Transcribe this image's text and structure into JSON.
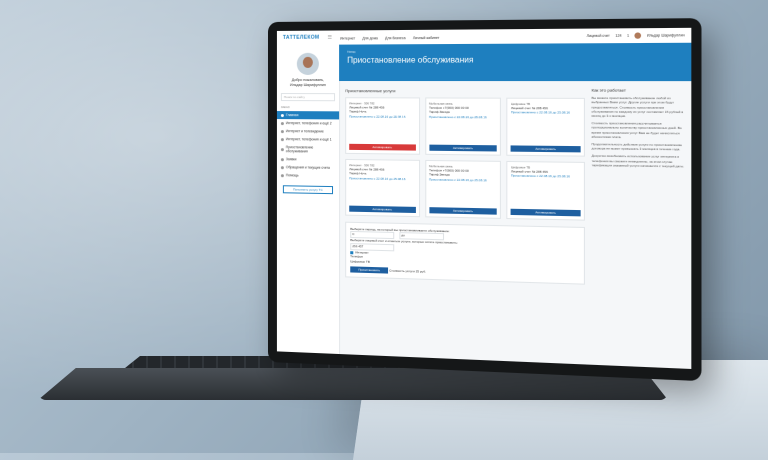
{
  "header": {
    "logo": "ТАТТЕЛЕКОМ",
    "nav": [
      "Интернет",
      "Для дома",
      "Для бизнеса",
      "Личный кабинет"
    ],
    "account_label": "Лицевой счет",
    "balance": "124",
    "notifications": "1",
    "user_name": "Ильдар Шарифуллин"
  },
  "sidebar": {
    "greeting": "Добро пожаловать,",
    "user": "Ильдар Шарифуллин",
    "search_placeholder": "Поиск по сайту",
    "section": "ЗАКАЗ",
    "items": [
      {
        "label": "Главная",
        "active": true
      },
      {
        "label": "Интернет, телефония и ещё 2"
      },
      {
        "label": "Интернет и телевидение"
      },
      {
        "label": "Интернет, телефония и ещё 1"
      },
      {
        "label": "Приостановление обслуживания"
      },
      {
        "label": "Заявки"
      },
      {
        "label": "Обращения и текущие счета"
      },
      {
        "label": "Помощь"
      }
    ],
    "button": "Пополнить услугу ТС"
  },
  "banner": {
    "crumb": "Назад",
    "title": "Приостановление обслуживания"
  },
  "section_title": "Приостановленные услуги",
  "cards": [
    {
      "type": "Интернет · 506 782",
      "account": "Лицевой счет № 288 456",
      "tariff": "Тариф Ночь",
      "period": "Приостановлено с 22.08.16 до 25.08.16",
      "button": "Активировать",
      "red": true
    },
    {
      "type": "Мобильная связь",
      "account": "Телефон +7(900) 000 00 00",
      "tariff": "Тариф Звезда",
      "period": "Приостановлено с 22.08.16 до 25.08.16",
      "button": "Активировать",
      "red": false
    },
    {
      "type": "Цифровое ТВ",
      "account": "Лицевой счет № 288 456",
      "tariff": "",
      "period": "Приостановлено с 22.08.16 до 25.08.16",
      "button": "Активировать",
      "red": false
    },
    {
      "type": "Интернет · 506 782",
      "account": "Лицевой счет № 288 456",
      "tariff": "Тариф Ночь",
      "period": "Приостановлено с 22.08.16 до 25.08.16",
      "button": "Активировать",
      "red": false
    },
    {
      "type": "Мобильная связь",
      "account": "Телефон +7(900) 000 00 00",
      "tariff": "Тариф Звезда",
      "period": "Приостановлено с 22.08.16 до 25.08.16",
      "button": "Активировать",
      "red": false
    },
    {
      "type": "Цифровое ТВ",
      "account": "Лицевой счет № 288 456",
      "tariff": "",
      "period": "Приостановлено с 22.08.16 до 25.08.16",
      "button": "Активировать",
      "red": false
    }
  ],
  "form": {
    "period_label": "Выберите период, на который вы приостанавливаете обслуживание:",
    "from": "С",
    "to": "до",
    "account_label": "Выберите лицевой счет и отметьте услуги, которые хотите приостановить:",
    "account_value": "256 457",
    "services": [
      "Интернет",
      "Телефон",
      "Цифровое ТВ"
    ],
    "submit": "Приостановить",
    "cost": "Стоимость услуги 25 руб."
  },
  "info": {
    "title": "Как это работает",
    "p1": "Вы можете приостановить обслуживание любой из выбранных Вами услуг. Другие услуги при этом будут предоставляться. Стоимость приостановления обслуживания по каждому из услуг составляет 15 рублей в месяц до 3-х месяцев.",
    "p2": "Стоимость приостановления рассчитывается пропорционально количеству приостановленных дней. Во время приостановления услуг Вам не будет начисляться абонентская плата.",
    "p3": "Продолжительность действия услуги по приостановлению договора не может превышать 3 месяцев в течение года.",
    "p4": "Досрочно возобновить использование услуг интернета и телефонии вы сможете немедленно, за этом случае тарификация оказанной услуги начинается с текущей даты."
  },
  "colors": {
    "primary": "#1e7fbf",
    "accent_red": "#d83a3a",
    "button_blue": "#1e5fa0"
  }
}
